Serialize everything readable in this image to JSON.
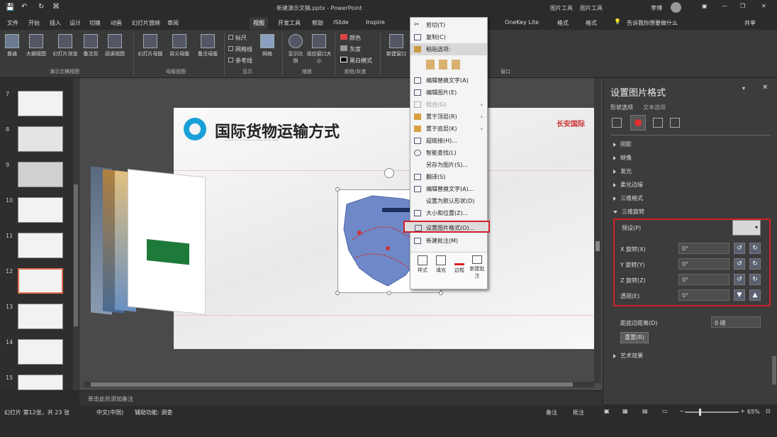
{
  "title_bar": {
    "doc_title": "新建演示文稿.pptx - PowerPoint",
    "context_tool_1": "图片工具",
    "context_tool_2": "图片工具",
    "user": "李博",
    "min": "—",
    "restore": "❐",
    "close": "✕"
  },
  "tabs": [
    "文件",
    "开始",
    "插入",
    "设计",
    "切换",
    "动画",
    "幻灯片放映",
    "审阅",
    "视图",
    "开发工具",
    "帮助",
    "iSlide",
    "Inspire",
    "OneKey Lite",
    "格式",
    "格式",
    "告诉我你想要做什么"
  ],
  "share": "共享",
  "ribbon": {
    "buttons": [
      "普通",
      "大纲视图",
      "幻灯片浏览",
      "备注页",
      "阅读视图",
      "幻灯片母版",
      "讲义母版",
      "备注母版",
      "网格",
      "显示比例",
      "适应窗口大小",
      "颜色",
      "灰度",
      "黑白模式",
      "新建窗口"
    ],
    "checks": [
      "标尺",
      "网格线",
      "参考线"
    ],
    "groups": [
      "演示文稿视图",
      "母版视图",
      "显示",
      "缩放",
      "颜色/灰度",
      "窗口"
    ]
  },
  "thumbs": [
    "7",
    "8",
    "9",
    "10",
    "11",
    "12",
    "13",
    "14",
    "15"
  ],
  "slide": {
    "title": "国际货物运输方式",
    "subtitle_line": "———— ——— ——— —— ——",
    "logo": "长安国际"
  },
  "context_menu": {
    "items": [
      {
        "label": "剪切(T)",
        "dis": false,
        "arrow": false
      },
      {
        "label": "复制(C)",
        "dis": false,
        "arrow": false
      },
      {
        "label": "粘贴选项:",
        "dis": false,
        "arrow": false
      },
      {
        "label": "",
        "dis": false,
        "arrow": false
      },
      {
        "label": "编辑替换文字(A)",
        "dis": false,
        "arrow": false
      },
      {
        "label": "编辑图片(E)",
        "dis": false,
        "arrow": false
      },
      {
        "label": "组合(G)",
        "dis": true,
        "arrow": true
      },
      {
        "label": "置于顶层(R)",
        "dis": false,
        "arrow": true
      },
      {
        "label": "置于底层(K)",
        "dis": false,
        "arrow": true
      },
      {
        "label": "超链接(H)...",
        "dis": false,
        "arrow": false
      },
      {
        "label": "智能查找(L)",
        "dis": false,
        "arrow": false
      },
      {
        "label": "另存为图片(S)...",
        "dis": false,
        "arrow": false
      },
      {
        "label": "翻译(S)",
        "dis": false,
        "arrow": false
      },
      {
        "label": "编辑替换文字(A)...",
        "dis": false,
        "arrow": false
      },
      {
        "label": "设置为默认形状(D)",
        "dis": false,
        "arrow": false
      },
      {
        "label": "大小和位置(Z)...",
        "dis": false,
        "arrow": false
      },
      {
        "label": "设置图片格式(O)...",
        "dis": false,
        "arrow": false
      },
      {
        "label": "新建批注(M)",
        "dis": false,
        "arrow": false
      }
    ],
    "mini": [
      "样式",
      "填充",
      "边框",
      "新建批注"
    ]
  },
  "pane": {
    "title": "设置图片格式",
    "tabs": [
      "形状选项",
      "文本选项"
    ],
    "sections": [
      "阴影",
      "映像",
      "发光",
      "柔化边缘",
      "三维格式",
      "三维旋转"
    ],
    "preset_label": "预设(P)",
    "rows": [
      "X 旋转(X)",
      "Y 旋转(Y)",
      "Z 旋转(Z)",
      "透视(E)"
    ],
    "values": [
      "0°",
      "0°",
      "0°",
      "0°"
    ],
    "distance_label": "距底边距离(D)",
    "distance_value": "0 磅",
    "reset": "重置(R)",
    "art": "艺术效果"
  },
  "notes": "单击此处添加备注",
  "status": {
    "left": "幻灯片 第12张，共 23 张",
    "lang": "中文(中国)",
    "acc": "辅助功能: 调查",
    "notes_btn": "备注",
    "comments_btn": "批注",
    "zoom": "65%"
  }
}
